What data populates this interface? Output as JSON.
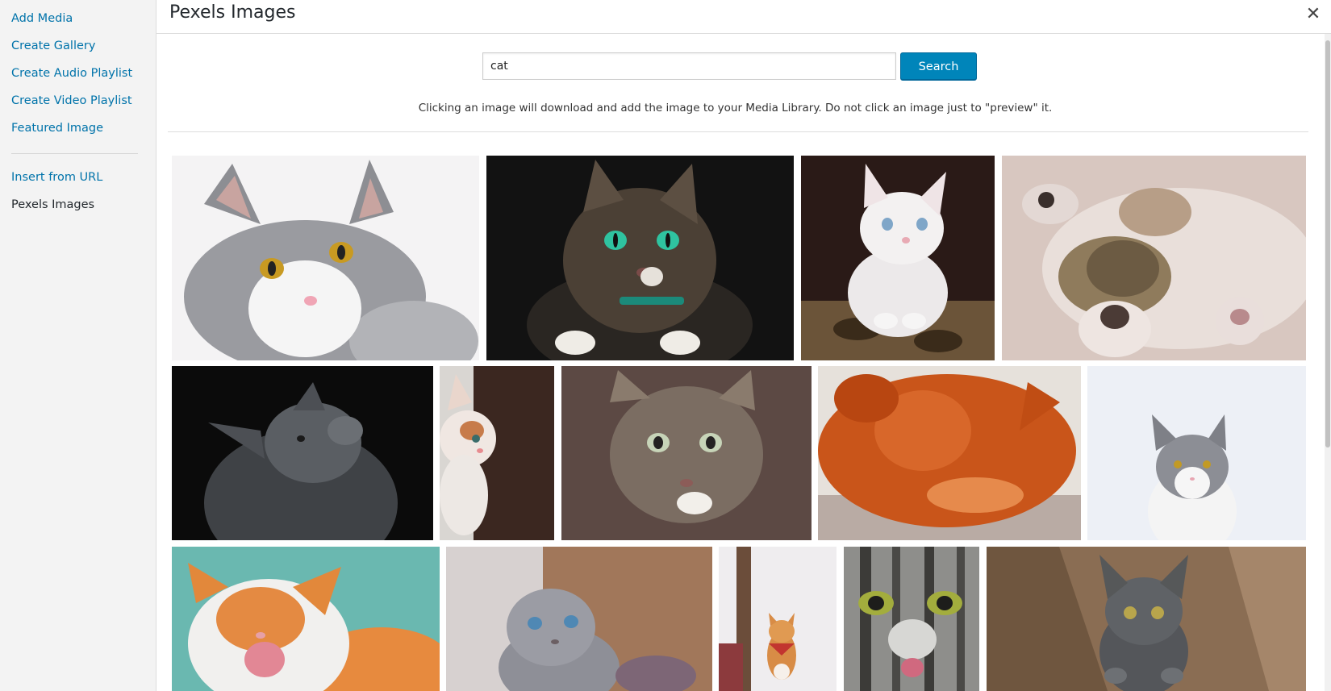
{
  "sidebar": {
    "items": [
      {
        "label": "Add Media"
      },
      {
        "label": "Create Gallery"
      },
      {
        "label": "Create Audio Playlist"
      },
      {
        "label": "Create Video Playlist"
      },
      {
        "label": "Featured Image"
      },
      {
        "label": "Insert from URL"
      },
      {
        "label": "Pexels Images"
      }
    ]
  },
  "header": {
    "title": "Pexels Images",
    "close_icon": "close-icon"
  },
  "search": {
    "value": "cat",
    "button_label": "Search"
  },
  "notice": "Clicking an image will download and add the image to your Media Library. Do not click an image just to \"preview\" it.",
  "colors": {
    "link": "#0073aa",
    "button": "#0085ba",
    "sidebar_bg": "#f3f3f3"
  }
}
